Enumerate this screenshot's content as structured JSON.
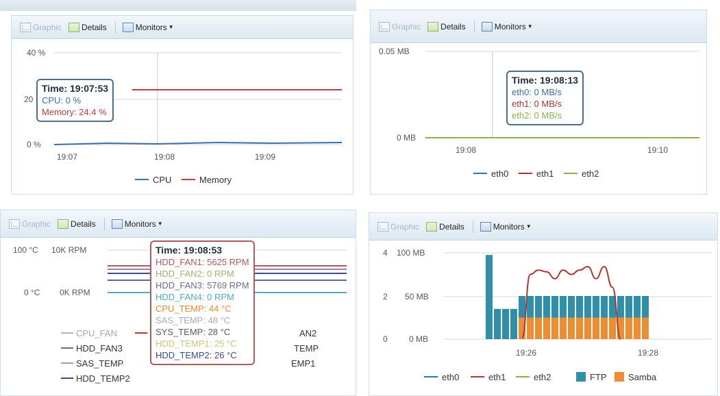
{
  "toolbar": {
    "graphic_label": "Graphic",
    "details_label": "Details",
    "monitors_label": "Monitors"
  },
  "colors": {
    "cpu": "#3a6fa8",
    "memory": "#c23b3b",
    "eth0": "#3a6fa8",
    "eth1": "#b03434",
    "eth2": "#8ab248",
    "ftp": "#2f8eaa",
    "samba": "#ee8c32",
    "cpu_fan": "#b6b6b6",
    "hdd_fan1": "#b05a5a",
    "hdd_fan2": "#9cb86a",
    "hdd_fan3": "#6a6f80",
    "hdd_fan4": "#54a9c0",
    "hdd_temp2": "#3d4a8c"
  },
  "panel_system": {
    "y_axis": [
      "40 %",
      "20",
      "0 %"
    ],
    "x_axis": [
      "19:07",
      "19:08",
      "19:09"
    ],
    "tooltip": {
      "time": "Time: 19:07:53",
      "cpu": "CPU: 0 %",
      "memory": "Memory: 24.4 %"
    },
    "legend": [
      "CPU",
      "Memory"
    ]
  },
  "panel_network": {
    "y_axis": [
      "0.05 MB",
      "0 MB"
    ],
    "x_axis": [
      "19:08",
      "19:10"
    ],
    "tooltip": {
      "time": "Time: 19:08:13",
      "eth0": "eth0: 0 MB/s",
      "eth1": "eth1: 0 MB/s",
      "eth2": "eth2: 0 MB/s"
    },
    "legend": [
      "eth0",
      "eth1",
      "eth2"
    ]
  },
  "panel_hardware": {
    "y_axis_temp": [
      "100 °C",
      "0 °C"
    ],
    "y_axis_rpm": [
      "10K RPM",
      "0K RPM"
    ],
    "tooltip": {
      "time": "Time: 19:08:53",
      "hdd_fan1": "HDD_FAN1: 5625 RPM",
      "hdd_fan2": "HDD_FAN2: 0 RPM",
      "hdd_fan3": "HDD_FAN3: 5769 RPM",
      "hdd_fan4": "HDD_FAN4: 0 RPM",
      "cpu_temp": "CPU_TEMP: 44 °C",
      "sas_temp": "SAS_TEMP: 48 °C",
      "sys_temp": "SYS_TEMP: 28 °C",
      "hdd_temp1": "HDD_TEMP1: 25 °C",
      "hdd_temp2": "HDD_TEMP2: 26 °C"
    },
    "legend": {
      "cpu_fan": "CPU_FAN",
      "hdd_fan3": "HDD_FAN3",
      "sas_temp": "SAS_TEMP",
      "hdd_temp2": "HDD_TEMP2",
      "fan2_partial": "AN2",
      "temp_partial": "TEMP",
      "emp1_partial": "EMP1"
    }
  },
  "panel_services": {
    "y_axis_left": [
      "4",
      "2",
      "0"
    ],
    "y_axis_right": [
      "100 MB",
      "50 MB",
      "0 MB"
    ],
    "x_axis": [
      "19:26",
      "19:28"
    ],
    "legend": [
      "eth0",
      "eth1",
      "eth2",
      "FTP",
      "Samba"
    ]
  },
  "chart_data": [
    {
      "type": "line",
      "title": "",
      "categories": [
        "19:07",
        "19:08",
        "19:09"
      ],
      "series": [
        {
          "name": "CPU",
          "values": [
            0.3,
            0.5,
            0.4
          ]
        },
        {
          "name": "Memory",
          "values": [
            24.4,
            24.4,
            24.4
          ]
        }
      ],
      "ylim": [
        0,
        40
      ],
      "grid": true,
      "legend": "bottom"
    },
    {
      "type": "line",
      "title": "",
      "categories": [
        "19:08",
        "19:10"
      ],
      "series": [
        {
          "name": "eth0",
          "values": [
            0,
            0
          ]
        },
        {
          "name": "eth1",
          "values": [
            0,
            0
          ]
        },
        {
          "name": "eth2",
          "values": [
            0,
            0
          ]
        }
      ],
      "ylim": [
        0,
        0.05
      ],
      "grid": true,
      "legend": "bottom"
    },
    {
      "type": "line",
      "title": "",
      "series": [
        {
          "name": "HDD_FAN1",
          "values": [
            5625,
            5625
          ]
        },
        {
          "name": "HDD_FAN2",
          "values": [
            0,
            0
          ]
        },
        {
          "name": "HDD_FAN3",
          "values": [
            5769,
            5769
          ]
        },
        {
          "name": "HDD_FAN4",
          "values": [
            0,
            0
          ]
        },
        {
          "name": "CPU_TEMP",
          "values": [
            44,
            44
          ]
        },
        {
          "name": "SAS_TEMP",
          "values": [
            48,
            48
          ]
        },
        {
          "name": "SYS_TEMP",
          "values": [
            28,
            28
          ]
        },
        {
          "name": "HDD_TEMP1",
          "values": [
            25,
            25
          ]
        },
        {
          "name": "HDD_TEMP2",
          "values": [
            26,
            26
          ]
        }
      ],
      "ylim": [
        0,
        100
      ],
      "grid": true,
      "legend": "bottom"
    },
    {
      "type": "bar",
      "title": "",
      "x_ticks": [
        "19:26",
        "19:28"
      ],
      "series": [
        {
          "name": "FTP",
          "values": [
            3.9,
            1.4,
            1.4,
            1.4,
            1,
            1,
            1,
            1,
            1,
            1,
            1,
            1,
            1,
            1,
            1,
            1,
            1,
            1,
            1,
            1
          ]
        },
        {
          "name": "Samba",
          "values": [
            0,
            0,
            0,
            0,
            1,
            1,
            1,
            1,
            1,
            1,
            1,
            1,
            1,
            1,
            1,
            1,
            1,
            1,
            1,
            1
          ]
        },
        {
          "name": "eth1",
          "values": [
            0,
            0,
            0,
            0,
            1.4,
            75,
            80,
            78,
            70,
            80,
            75,
            80,
            84,
            70,
            84,
            60,
            0,
            0,
            0,
            0
          ]
        }
      ],
      "ylim": [
        0,
        4
      ],
      "ylim_right": [
        0,
        100
      ],
      "grid": true,
      "legend": "bottom"
    }
  ]
}
